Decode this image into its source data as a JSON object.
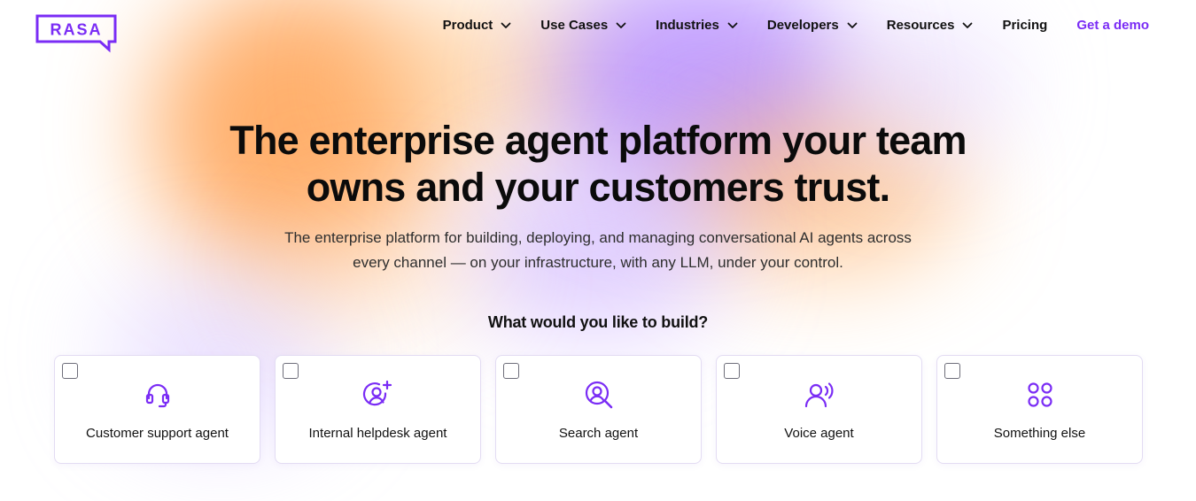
{
  "brand": {
    "logo_text": "RASA",
    "accent": "#7a2cf5"
  },
  "nav": {
    "items": [
      {
        "label": "Product",
        "icon": "chevron-down-icon"
      },
      {
        "label": "Use Cases",
        "icon": "chevron-down-icon"
      },
      {
        "label": "Industries",
        "icon": "chevron-down-icon"
      },
      {
        "label": "Developers",
        "icon": "chevron-down-icon"
      },
      {
        "label": "Resources",
        "icon": "chevron-down-icon"
      },
      {
        "label": "Pricing"
      }
    ],
    "cta": "Get a demo"
  },
  "hero": {
    "headline_line1": "The enterprise agent platform your team",
    "headline_line2": "owns and your customers trust.",
    "subheading_line1": "The enterprise platform for building, deploying, and managing conversational AI agents across",
    "subheading_line2": "every channel — on your infrastructure, with any LLM, under your control."
  },
  "build": {
    "question": "What would you like to build?",
    "options": [
      {
        "label": "Customer support agent",
        "icon": "headset-icon",
        "checked": false
      },
      {
        "label": "Internal helpdesk agent",
        "icon": "user-plus-icon",
        "checked": false
      },
      {
        "label": "Search agent",
        "icon": "user-search-icon",
        "checked": false
      },
      {
        "label": "Voice agent",
        "icon": "voice-user-icon",
        "checked": false
      },
      {
        "label": "Something else",
        "icon": "four-circles-icon",
        "checked": false
      }
    ]
  }
}
